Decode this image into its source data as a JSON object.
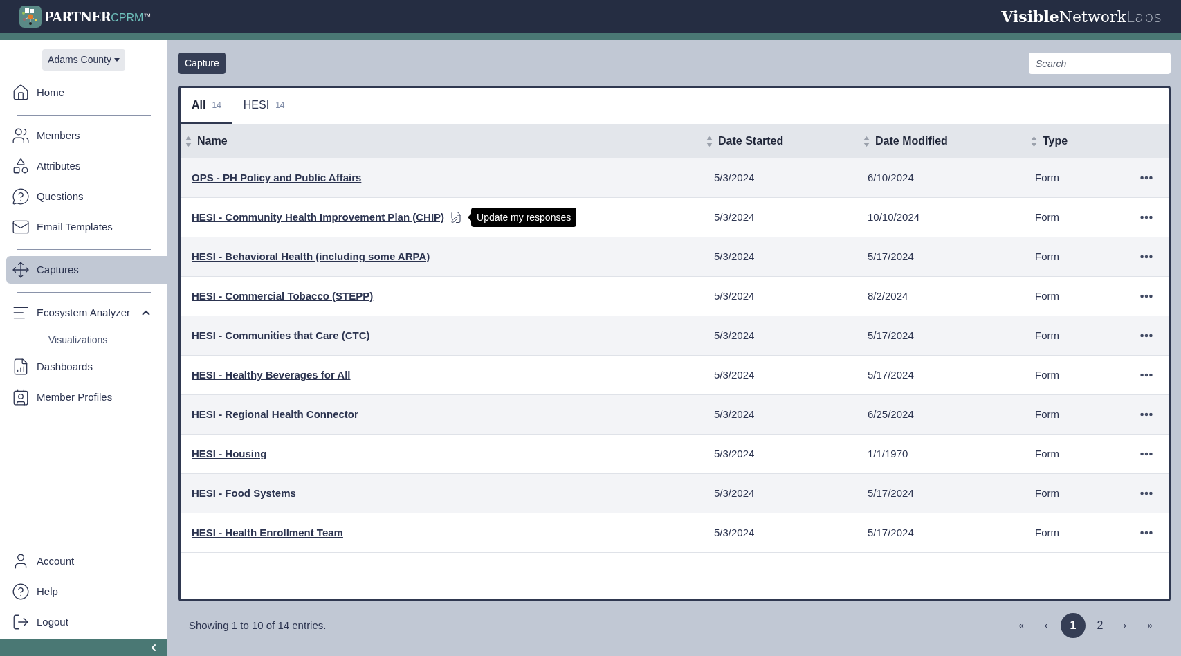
{
  "header": {
    "brand": {
      "name": "PARTNER",
      "suffix": "CPRM",
      "mark": "™"
    },
    "partner_logo": {
      "part_1": "Visible",
      "part_2": "Network",
      "part_3": "Labs"
    }
  },
  "sidebar": {
    "org_selector": "Adams County",
    "sections": [
      [
        {
          "kind": "home",
          "label": "Home",
          "selected": false
        }
      ],
      [
        {
          "kind": "members",
          "label": "Members",
          "selected": false
        },
        {
          "kind": "attributes",
          "label": "Attributes",
          "selected": false
        },
        {
          "kind": "questions",
          "label": "Questions",
          "selected": false
        },
        {
          "kind": "email",
          "label": "Email Templates",
          "selected": false
        }
      ],
      [
        {
          "kind": "captures",
          "label": "Captures",
          "selected": true
        }
      ],
      [
        {
          "kind": "analyzer",
          "label": "Ecosystem Analyzer",
          "selected": false,
          "expanded": true,
          "children": [
            {
              "label": "Visualizations",
              "selected": false
            }
          ]
        },
        {
          "kind": "dashboards",
          "label": "Dashboards",
          "selected": false
        },
        {
          "kind": "profiles",
          "label": "Member Profiles",
          "selected": false
        }
      ]
    ],
    "bottom_items": [
      {
        "kind": "account",
        "label": "Account"
      },
      {
        "kind": "help",
        "label": "Help"
      },
      {
        "kind": "logout",
        "label": "Logout"
      }
    ]
  },
  "toolbar": {
    "button": "Capture",
    "search": {
      "placeholder": "Search"
    }
  },
  "tabs": [
    {
      "label": "All",
      "count": "14",
      "selected": true
    },
    {
      "label": "HESI",
      "count": "14",
      "selected": false
    }
  ],
  "table": {
    "columns": [
      "Name",
      "Date Started",
      "Date Modified",
      "Type"
    ],
    "rows": [
      {
        "name": "OPS - PH Policy and Public Affairs",
        "date_started": "5/3/2024",
        "date_modified": "6/10/2024",
        "type": "Form",
        "hovered": false
      },
      {
        "name": "HESI - Community Health Improvement Plan (CHIP)",
        "date_started": "5/3/2024",
        "date_modified": "10/10/2024",
        "type": "Form",
        "hovered": true,
        "tooltip": "Update my responses"
      },
      {
        "name": "HESI - Behavioral Health (including some ARPA)",
        "date_started": "5/3/2024",
        "date_modified": "5/17/2024",
        "type": "Form",
        "hovered": false
      },
      {
        "name": "HESI - Commercial Tobacco (STEPP)",
        "date_started": "5/3/2024",
        "date_modified": "8/2/2024",
        "type": "Form",
        "hovered": false
      },
      {
        "name": "HESI - Communities that Care (CTC)",
        "date_started": "5/3/2024",
        "date_modified": "5/17/2024",
        "type": "Form",
        "hovered": false
      },
      {
        "name": "HESI - Healthy Beverages for All",
        "date_started": "5/3/2024",
        "date_modified": "5/17/2024",
        "type": "Form",
        "hovered": false
      },
      {
        "name": "HESI - Regional Health Connector",
        "date_started": "5/3/2024",
        "date_modified": "6/25/2024",
        "type": "Form",
        "hovered": false
      },
      {
        "name": "HESI - Housing",
        "date_started": "5/3/2024",
        "date_modified": "1/1/1970",
        "type": "Form",
        "hovered": false
      },
      {
        "name": "HESI - Food Systems",
        "date_started": "5/3/2024",
        "date_modified": "5/17/2024",
        "type": "Form",
        "hovered": false
      },
      {
        "name": "HESI - Health Enrollment Team",
        "date_started": "5/3/2024",
        "date_modified": "5/17/2024",
        "type": "Form",
        "hovered": false
      }
    ]
  },
  "footer": {
    "summary": "Showing 1 to 10 of 14 entries.",
    "pagination": [
      {
        "kind": "first",
        "text": "«",
        "selected": false
      },
      {
        "kind": "prev",
        "text": "‹",
        "selected": false
      },
      {
        "kind": "page",
        "text": "1",
        "selected": true
      },
      {
        "kind": "page",
        "text": "2",
        "selected": false
      },
      {
        "kind": "next",
        "text": "›",
        "selected": false
      },
      {
        "kind": "last",
        "text": "»",
        "selected": false
      }
    ]
  }
}
